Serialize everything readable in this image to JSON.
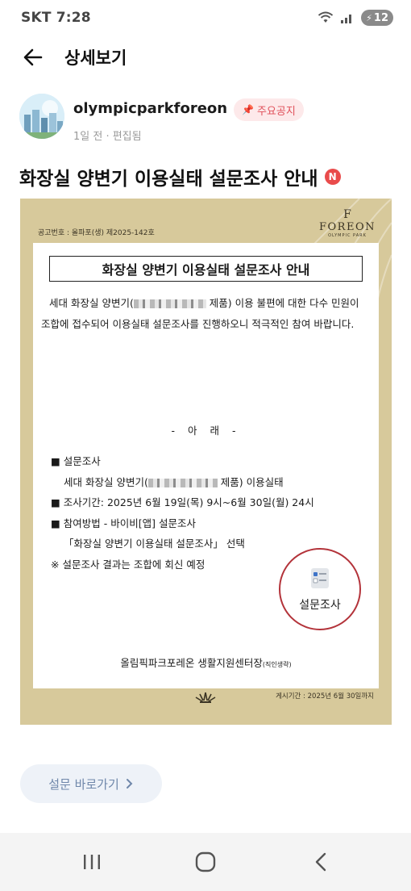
{
  "status_bar": {
    "carrier_time": "SKT 7:28",
    "battery": "12",
    "icons": [
      "wifi-icon",
      "signal-icon",
      "battery-icon"
    ]
  },
  "header": {
    "title": "상세보기",
    "back_icon": "arrow-left-icon"
  },
  "post": {
    "author": "olympicparkforeon",
    "badge": "주요공지",
    "badge_icon": "pin-icon",
    "meta": "1일 전 · 편집됨",
    "title": "화장실 양변기 이용실태 설문조사 안내",
    "title_badge": "N"
  },
  "poster": {
    "ref_no": "공고번호 : 올파포(생) 제2025-142호",
    "logo_mark": "F",
    "logo_text": "FOREON",
    "logo_sub": "OLYMPIC PARK",
    "title": "화장실 양변기 이용실태 설문조사 안내",
    "intro_a": "세대 화장실 양변기(",
    "intro_b": " 제품) 이용 불편에 대한 다수 민원이 조합에 접수되어 이용실태 설문조사를 진행하오니 적극적인 참여 바랍니다.",
    "arae": "- 아 래 -",
    "item1": "■ 설문조사",
    "item1_sub_a": "세대 화장실 양변기(",
    "item1_sub_b": " 제품) 이용실태",
    "item2": "■ 조사기간: 2025년 6월 19일(목) 9시~6월 30일(월) 24시",
    "item3": "■ 참여방법 - 바이비[앱] 설문조사",
    "item3_sub": "「화장실 양변기 이용실태 설문조사」 선택",
    "note": "※ 설문조사 결과는 조합에 회신 예정",
    "survey_label": "설문조사",
    "footer": "올림픽파크포레온 생활지원센터장",
    "footer_small": "(직인생략)",
    "period": "게시기간 : 2025년 6월 30일까지"
  },
  "survey_link": {
    "label": "설문 바로가기",
    "icon": "chevron-right-icon"
  },
  "nav": {
    "icons": [
      "recent-apps-icon",
      "home-icon",
      "back-icon"
    ]
  },
  "colors": {
    "badge_bg": "#fde9ea",
    "badge_text": "#e0505a",
    "poster_bg": "#d7c99b",
    "circle": "#b3333a",
    "link_text": "#6f87aa"
  }
}
